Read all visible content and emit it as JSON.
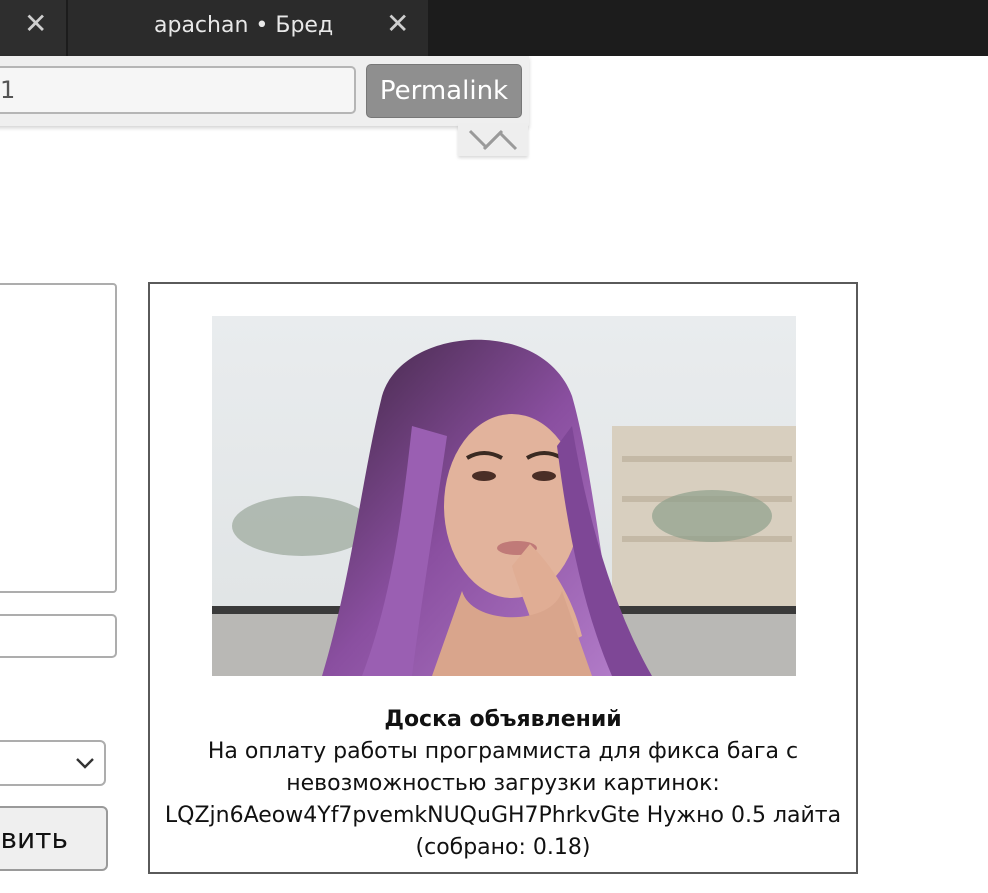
{
  "tabs": {
    "previous_close": "✕",
    "active_title": "apachan • Бред",
    "active_close": "✕"
  },
  "permalink_panel": {
    "link_value": "1",
    "permalink_label": "Permalink",
    "toggle_icon": "double-chevron-icon"
  },
  "form": {
    "submit_label_partial": "вить",
    "select_icon": "chevron-down-icon"
  },
  "ad": {
    "title": "Доска объявлений",
    "body": "На оплату работы программиста для фикса бага с невозможностью загрузки картинок: LQZjn6Aeow4Yf7pvemkNUQuGH7PhrkvGte Нужно 0.5 лайта (собрано: 0.18)"
  }
}
